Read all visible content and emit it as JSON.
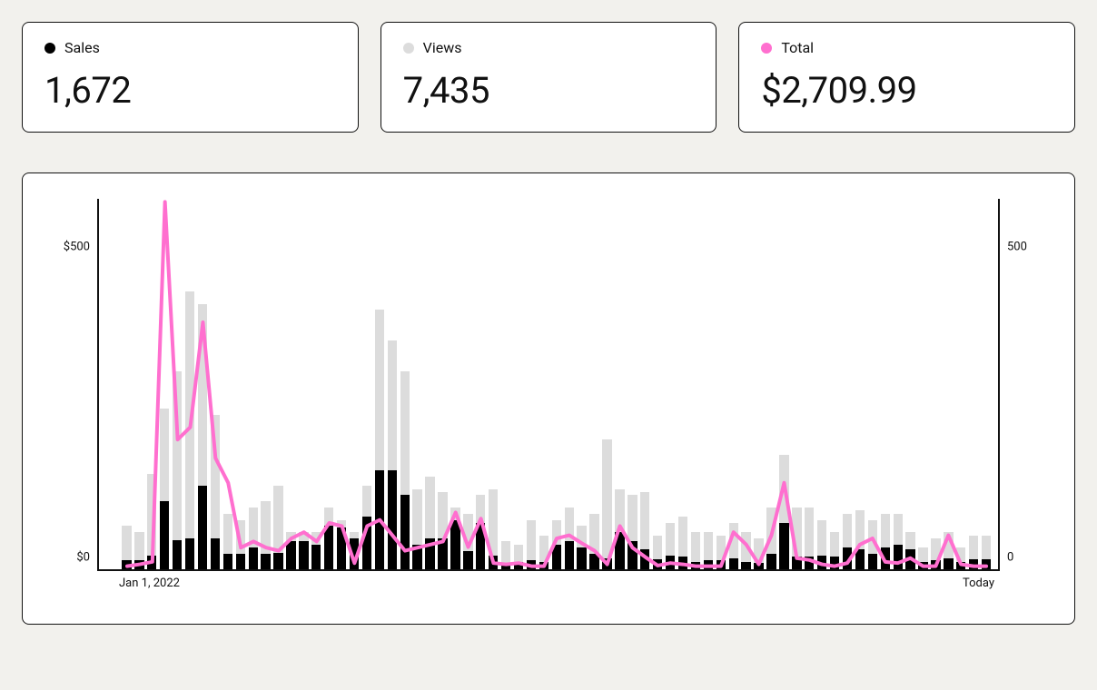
{
  "cards": [
    {
      "name": "sales",
      "label": "Sales",
      "value": "1,672",
      "dot": "black"
    },
    {
      "name": "views",
      "label": "Views",
      "value": "7,435",
      "dot": "grey"
    },
    {
      "name": "total",
      "label": "Total",
      "value": "$2,709.99",
      "dot": "pink"
    }
  ],
  "chart_data": {
    "type": "bar",
    "title": "",
    "x_start_label": "Jan 1, 2022",
    "x_end_label": "Today",
    "left_axis": {
      "label": "",
      "ticks": [
        0,
        500
      ],
      "tick_labels": [
        "$0",
        "$500"
      ],
      "max": 600
    },
    "right_axis": {
      "label": "",
      "ticks": [
        0,
        500
      ],
      "tick_labels": [
        "0",
        "500"
      ],
      "max": 600
    },
    "series": [
      {
        "name": "Views",
        "type": "bar",
        "axis": "right",
        "color": "#dcdcdc",
        "values": [
          70,
          60,
          155,
          260,
          320,
          450,
          430,
          250,
          90,
          80,
          100,
          110,
          135,
          60,
          60,
          60,
          100,
          80,
          60,
          135,
          420,
          370,
          320,
          130,
          150,
          125,
          100,
          90,
          120,
          130,
          45,
          40,
          80,
          55,
          80,
          100,
          70,
          90,
          210,
          130,
          120,
          125,
          55,
          75,
          85,
          60,
          60,
          55,
          75,
          60,
          50,
          100,
          185,
          100,
          100,
          80,
          60,
          90,
          95,
          80,
          90,
          90,
          60,
          35,
          50,
          60,
          35,
          55,
          55
        ]
      },
      {
        "name": "Sales",
        "type": "bar",
        "axis": "right",
        "color": "#000000",
        "values": [
          15,
          15,
          22,
          110,
          47,
          50,
          135,
          50,
          25,
          25,
          35,
          25,
          27,
          45,
          45,
          40,
          70,
          68,
          50,
          85,
          160,
          160,
          120,
          40,
          50,
          50,
          80,
          30,
          75,
          22,
          10,
          12,
          15,
          12,
          40,
          45,
          35,
          25,
          18,
          60,
          45,
          32,
          16,
          22,
          20,
          12,
          14,
          14,
          18,
          12,
          10,
          25,
          75,
          20,
          20,
          22,
          20,
          35,
          32,
          25,
          35,
          40,
          32,
          12,
          15,
          18,
          12,
          16,
          16
        ]
      },
      {
        "name": "Total",
        "type": "line",
        "axis": "left",
        "color": "#ff6fcf",
        "values": [
          5,
          8,
          12,
          595,
          210,
          230,
          400,
          180,
          140,
          35,
          45,
          35,
          30,
          50,
          60,
          45,
          75,
          70,
          10,
          70,
          80,
          55,
          30,
          35,
          40,
          45,
          92,
          36,
          82,
          10,
          8,
          10,
          5,
          5,
          50,
          55,
          42,
          30,
          8,
          70,
          35,
          20,
          6,
          10,
          8,
          5,
          5,
          5,
          60,
          40,
          8,
          55,
          140,
          18,
          15,
          8,
          5,
          10,
          40,
          50,
          12,
          10,
          18,
          5,
          5,
          55,
          8,
          5,
          5
        ]
      }
    ],
    "colors": {
      "sales_bar": "#000000",
      "views_bar": "#dcdcdc",
      "total_line": "#ff6fcf"
    }
  }
}
